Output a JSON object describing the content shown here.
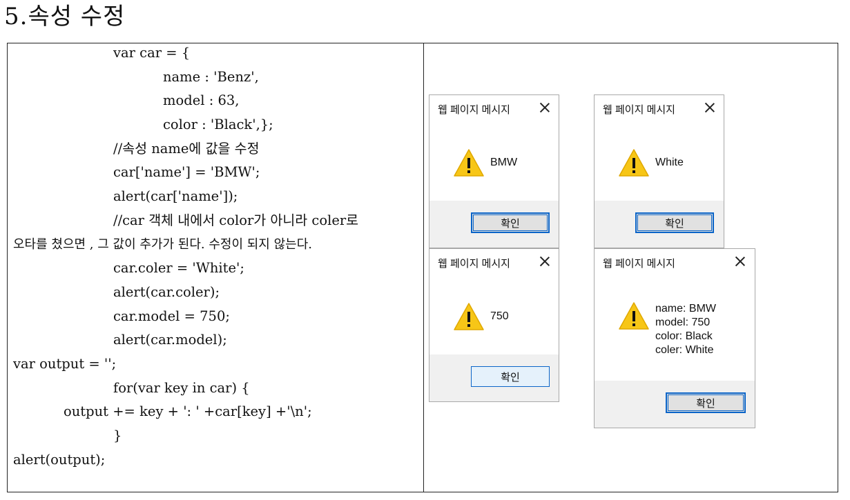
{
  "heading": "5.속성 수정",
  "code": {
    "lines": [
      "var car = {",
      "name : 'Benz',",
      "model : 63,",
      "color : 'Black',};",
      "//속성 name에 값을 수정",
      "car['name'] = 'BMW';",
      "alert(car['name']);",
      "//car 객체 내에서 color가 아니라 coler로",
      "오타를 쳤으면 , 그 값이 추가가 된다. 수정이 되지 않는다.",
      "car.coler = 'White';",
      "alert(car.coler);",
      "car.model = 750;",
      "alert(car.model);",
      "var output = '';",
      "for(var key in car) {",
      "output += key + ': ' +car[key] +'\\n';",
      "}",
      "alert(output);"
    ]
  },
  "dialogs": [
    {
      "title": "웹 페이지 메시지",
      "message": "BMW",
      "ok_label": "확인",
      "icon": "warning-icon"
    },
    {
      "title": "웹 페이지 메시지",
      "message": "White",
      "ok_label": "확인",
      "icon": "warning-icon"
    },
    {
      "title": "웹 페이지 메시지",
      "message": "750",
      "ok_label": "확인",
      "icon": "warning-icon"
    },
    {
      "title": "웹 페이지 메시지",
      "message": "name: BMW\nmodel: 750\ncolor: Black\ncoler: White",
      "ok_label": "확인",
      "icon": "warning-icon"
    }
  ],
  "colors": {
    "warning_fill": "#f7c617",
    "button_border": "#0a64c8",
    "footer_bg": "#f0f0f0"
  }
}
